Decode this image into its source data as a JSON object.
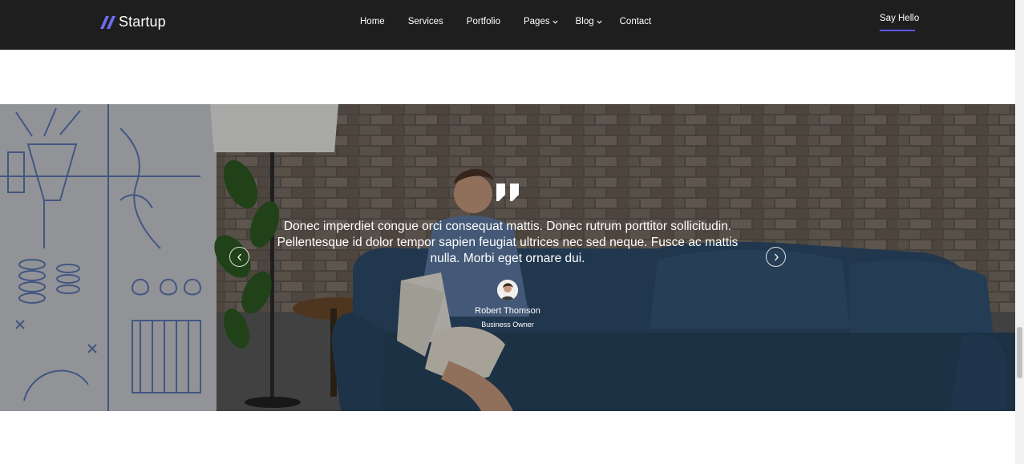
{
  "header": {
    "logo_text": "Startup",
    "nav": [
      {
        "label": "Home"
      },
      {
        "label": "Services"
      },
      {
        "label": "Portfolio"
      },
      {
        "label": "Pages"
      },
      {
        "label": "Blog"
      },
      {
        "label": "Contact"
      }
    ],
    "cta_label": "Say Hello",
    "accent_color": "#5a58e6"
  },
  "testimonial": {
    "quote": "Donec imperdiet congue orci consequat mattis. Donec rutrum porttitor sollicitudin. Pellentesque id dolor tempor sapien feugiat ultrices nec sed neque. Fusce ac mattis nulla. Morbi eget ornare dui.",
    "author_name": "Robert Thomson",
    "author_role": "Business Owner",
    "icons": {
      "quote": "quote-icon",
      "prev": "chevron-left-icon",
      "next": "chevron-right-icon"
    }
  }
}
